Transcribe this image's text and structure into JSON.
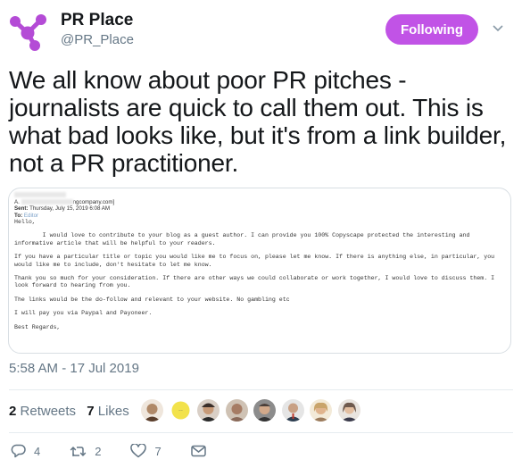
{
  "header": {
    "display_name": "PR Place",
    "handle": "@PR_Place",
    "follow_label": "Following",
    "brand_color": "#c153e6"
  },
  "tweet": {
    "text": "We all know about poor PR pitches - journalists are quick to call them out. This is what bad looks like, but it's from a link builder, not a PR practitioner.",
    "timestamp": "5:58 AM - 17 Jul 2019"
  },
  "email": {
    "from_line": "A.",
    "address_fragment": "ngcompany.com]",
    "sent_label": "Sent:",
    "sent_value": "Thursday, July 15, 2019 6:08 AM",
    "to_label": "To:",
    "to_value": "Editor",
    "greeting": "Hello,",
    "para1": "        I would love to contribute to your blog as a guest author. I can provide you 100% Copyscape protected the interesting and\ninformative article that will be helpful to your readers.",
    "para2": "If you have a particular title or topic you would like me to focus on, please let me know. If there is anything else, in particular, you\nwould like me to include, don't hesitate to let me know.",
    "para3": "Thank you so much for your consideration. If there are other ways we could collaborate or work together, I would love to discuss them. I\nlook forward to hearing from you.",
    "para4": "The links would be the do-follow and relevant to your website. No gambling etc",
    "para5": "I will pay you via Paypal and Payoneer.",
    "signoff": "Best Regards,"
  },
  "stats": {
    "retweets_count": "2",
    "retweets_label": "Retweets",
    "likes_count": "7",
    "likes_label": "Likes"
  },
  "avatars": [
    {
      "color": "#b08968"
    },
    {
      "color": "#f2e24b"
    },
    {
      "color": "#3b2f2a"
    },
    {
      "color": "#8a6a5a"
    },
    {
      "color": "#4a3f3a"
    },
    {
      "color": "#2c3e50"
    },
    {
      "color": "#c9a46b"
    },
    {
      "color": "#6f5a4e"
    }
  ],
  "actions": {
    "reply_count": "4",
    "retweet_count": "2",
    "like_count": "7"
  },
  "icons": [
    "logo-icon",
    "chevron-down-icon",
    "reply-icon",
    "retweet-icon",
    "heart-icon",
    "message-icon"
  ]
}
